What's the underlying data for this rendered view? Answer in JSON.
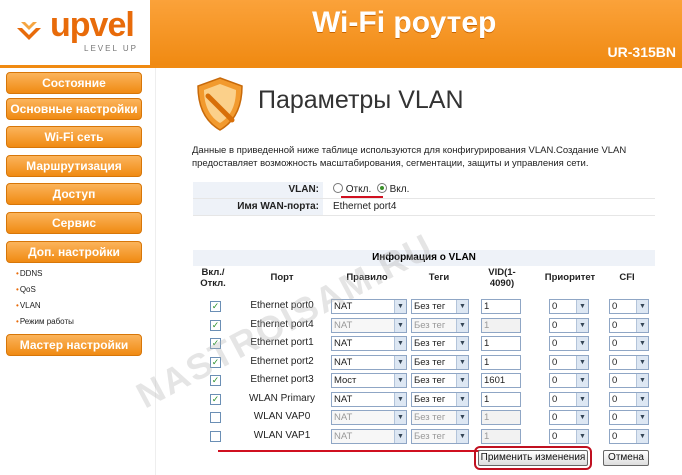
{
  "brand": {
    "logo": "upvel",
    "logo_sub": "LEVEL UP",
    "title": "Wi-Fi роутер",
    "model": "UR-315BN"
  },
  "sidebar": {
    "items": [
      "Состояние",
      "Основные настройки",
      "Wi-Fi сеть",
      "Маршрутизация",
      "Доступ",
      "Сервис",
      "Доп. настройки"
    ],
    "sub_items": [
      "DDNS",
      "QoS",
      "VLAN",
      "Режим работы"
    ],
    "wizard": "Мастер настройки"
  },
  "page": {
    "title": "Параметры VLAN",
    "description": "Данные в приведенной ниже таблице используются для конфигурирования VLAN.Создание VLAN предоставляет возможность масштабирования, сегментации, защиты и управления сети."
  },
  "form": {
    "vlan_label": "VLAN:",
    "off_label": "Откл.",
    "on_label": "Вкл.",
    "vlan_enabled": true,
    "wan_label": "Имя WAN-порта:",
    "wan_value": "Ethernet port4"
  },
  "table": {
    "title": "Информация о VLAN",
    "headers": {
      "enable": "Вкл./ Откл.",
      "port": "Порт",
      "rule": "Правило",
      "tags": "Теги",
      "vid": "VID(1-4090)",
      "priority": "Приоритет",
      "cfi": "CFI"
    },
    "rows": [
      {
        "checked": true,
        "port": "Ethernet port0",
        "rule": "NAT",
        "tags": "Без тег",
        "vid": "1",
        "priority": "0",
        "cfi": "0",
        "disabled": false
      },
      {
        "checked": true,
        "port": "Ethernet port4",
        "rule": "NAT",
        "tags": "Без тег",
        "vid": "1",
        "priority": "0",
        "cfi": "0",
        "disabled": true
      },
      {
        "checked": true,
        "port": "Ethernet port1",
        "rule": "NAT",
        "tags": "Без тег",
        "vid": "1",
        "priority": "0",
        "cfi": "0",
        "disabled": false
      },
      {
        "checked": true,
        "port": "Ethernet port2",
        "rule": "NAT",
        "tags": "Без тег",
        "vid": "1",
        "priority": "0",
        "cfi": "0",
        "disabled": false
      },
      {
        "checked": true,
        "port": "Ethernet port3",
        "rule": "Мост",
        "tags": "Без тег",
        "vid": "1601",
        "priority": "0",
        "cfi": "0",
        "disabled": false
      },
      {
        "checked": true,
        "port": "WLAN Primary",
        "rule": "NAT",
        "tags": "Без тег",
        "vid": "1",
        "priority": "0",
        "cfi": "0",
        "disabled": false
      },
      {
        "checked": false,
        "port": "WLAN VAP0",
        "rule": "NAT",
        "tags": "Без тег",
        "vid": "1",
        "priority": "0",
        "cfi": "0",
        "disabled": true
      },
      {
        "checked": false,
        "port": "WLAN VAP1",
        "rule": "NAT",
        "tags": "Без тег",
        "vid": "1",
        "priority": "0",
        "cfi": "0",
        "disabled": true
      }
    ]
  },
  "buttons": {
    "apply": "Применить изменения",
    "cancel": "Отмена"
  },
  "watermark": "NASTROISAM.RU",
  "colors": {
    "accent": "#f08a12",
    "annotation": "#d01020"
  }
}
